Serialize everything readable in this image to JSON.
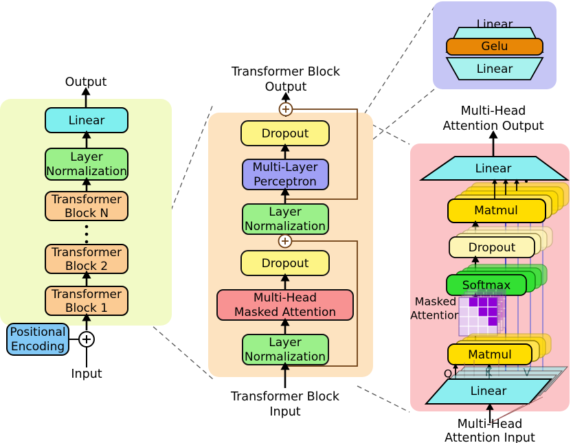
{
  "diagram": {
    "title_present": false,
    "panels": {
      "model": {
        "name": "full-model-panel",
        "bg": "#f2fac6",
        "top_label": "Output",
        "bottom_label": "Input",
        "blocks": [
          {
            "label": "Linear",
            "color": "#7fefef"
          },
          {
            "label": "Layer\nNormalization",
            "color": "#9bf08a",
            "line1": "Layer",
            "line2": "Normalization"
          },
          {
            "label": "Transformer Block N",
            "color": "#fbcb93",
            "line1": "Transformer",
            "line2": "Block N"
          },
          {
            "label": "dots",
            "color": "none"
          },
          {
            "label": "Transformer Block 2",
            "color": "#fbcb93",
            "line1": "Transformer",
            "line2": "Block 2"
          },
          {
            "label": "Transformer Block 1",
            "color": "#fbcb93",
            "line1": "Transformer",
            "line2": "Block 1"
          }
        ],
        "positional_encoding": {
          "line1": "Positional",
          "line2": "Encoding",
          "color": "#82c8f5"
        },
        "add_symbol": "+"
      },
      "block": {
        "name": "transformer-block-panel",
        "bg": "#fde3c0",
        "top_label_line1": "Transformer Block",
        "top_label_line2": "Output",
        "bottom_label_line1": "Transformer Block",
        "bottom_label_line2": "Input",
        "add_symbol": "+",
        "blocks": [
          {
            "label": "Dropout",
            "color": "#fdf485"
          },
          {
            "line1": "Multi-Layer",
            "line2": "Perceptron",
            "color": "#a0a0f5"
          },
          {
            "line1": "Layer",
            "line2": "Normalization",
            "color": "#9bf08a"
          },
          {
            "label": "Dropout",
            "color": "#fdf485"
          },
          {
            "line1": "Multi-Head",
            "line2": "Masked Attention",
            "color": "#f89292"
          },
          {
            "line1": "Layer",
            "line2": "Normalization",
            "color": "#9bf08a"
          }
        ]
      },
      "mlp": {
        "name": "mlp-detail-panel",
        "bg": "#c6c6f5",
        "blocks": [
          {
            "label": "Linear",
            "color": "#a8f2ee",
            "shape": "trapezoid-down"
          },
          {
            "label": "Gelu",
            "color": "#e88706",
            "shape": "rect"
          },
          {
            "label": "Linear",
            "color": "#a8f2ee",
            "shape": "trapezoid-up"
          }
        ]
      },
      "attention": {
        "name": "multi-head-attention-panel",
        "bg": "#fbc4c7",
        "top_label_line1": "Multi-Head",
        "top_label_line2": "Attention Output",
        "bottom_label_line1": "Multi-Head",
        "bottom_label_line2": "Attention Input",
        "mask_label_line1": "Masked",
        "mask_label_line2": "Attention",
        "qkv": [
          "Q",
          "K",
          "V"
        ],
        "blocks": [
          {
            "label": "Linear",
            "color": "#8ceef0",
            "shape": "trapezoid-up"
          },
          {
            "label": "Matmul",
            "color": "#ffdd00",
            "shape": "stack"
          },
          {
            "label": "Dropout",
            "color": "#fdf5b5",
            "shape": "stack"
          },
          {
            "label": "Softmax",
            "color": "#33e033",
            "shape": "stack"
          },
          {
            "label": "Matmul",
            "color": "#ffdd00",
            "shape": "stack"
          },
          {
            "label": "Linear",
            "color": "#8ceef0",
            "shape": "trapezoid-down-wide"
          }
        ],
        "mask_grid": {
          "rows": 4,
          "cols": 4,
          "pattern": [
            [
              0,
              1,
              1,
              1
            ],
            [
              0,
              0,
              1,
              1
            ],
            [
              0,
              0,
              0,
              1
            ],
            [
              0,
              0,
              0,
              0
            ]
          ],
          "masked_color": "#8f00d6",
          "unmasked_color": "#e6cdf0"
        }
      }
    },
    "colors": {
      "stroke": "#000000",
      "dash_connector": "#555555",
      "v_path": "#5555dd"
    }
  }
}
